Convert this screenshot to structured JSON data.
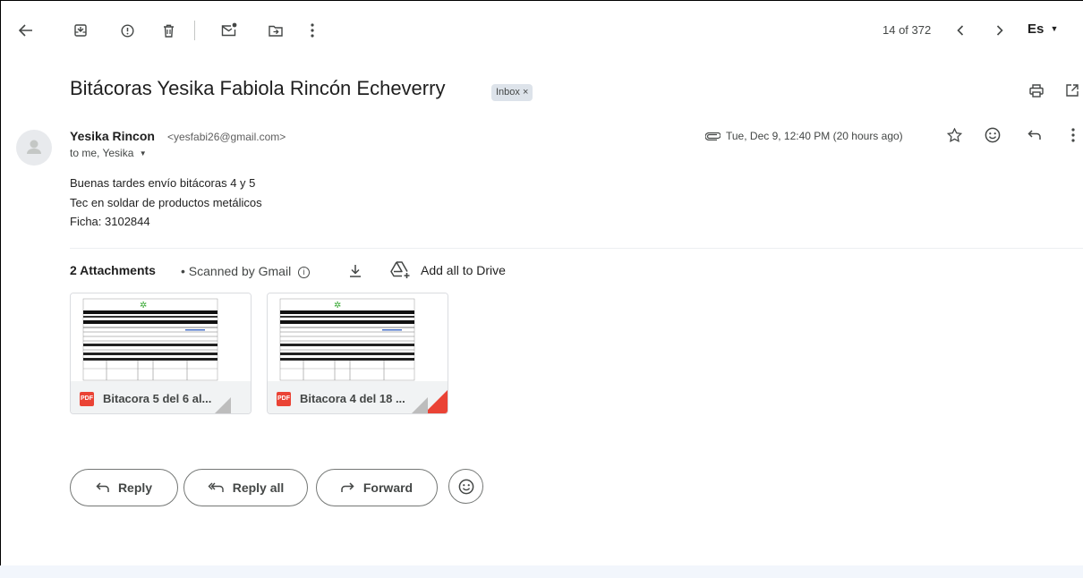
{
  "toolbar": {
    "back_icon": "arrow-left-icon",
    "archive_icon": "archive-icon",
    "report_spam_icon": "report-icon",
    "delete_icon": "trash-icon",
    "mark_unread_icon": "mark-unread-icon",
    "move_to_icon": "move-to-icon",
    "more_icon": "more-vert-icon",
    "pager": "14 of 372",
    "language": "Es"
  },
  "email": {
    "subject": "Bitácoras Yesika Fabiola Rincón Echeverry",
    "label_chip": "Inbox ×",
    "sender_name": "Yesika Rincon",
    "sender_email": "<yesfabi26@gmail.com>",
    "to": "to me, Yesika",
    "date": "Tue, Dec 9, 12:40 PM (20 hours ago)",
    "body": [
      "Buenas tardes envío bitácoras 4 y 5",
      "Tec en soldar de productos metálicos",
      "Ficha: 3102844"
    ]
  },
  "attachments": {
    "title": "2 Attachments",
    "scanned": "•  Scanned by Gmail",
    "add_drive": "Add all to Drive",
    "items": [
      {
        "name": "Bitacora 5 del 6 al...",
        "type": "PDF"
      },
      {
        "name": "Bitacora 4 del 18 ...",
        "type": "PDF"
      }
    ]
  },
  "actions": {
    "reply": "Reply",
    "reply_all": "Reply all",
    "forward": "Forward"
  },
  "colors": {
    "pdf_red": "#ea4335",
    "chip_bg": "#dde3ea",
    "strip_bg": "#f2f6fc"
  }
}
